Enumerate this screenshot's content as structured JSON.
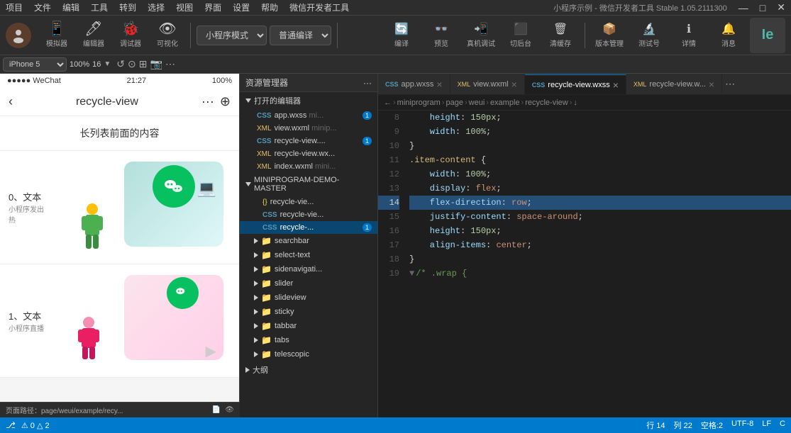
{
  "menu": {
    "items": [
      "项目",
      "文件",
      "编辑",
      "工具",
      "转到",
      "选择",
      "视图",
      "界面",
      "设置",
      "帮助",
      "微信开发者工具"
    ],
    "title_right": "小程序示例 - 微信开发者工具 Stable 1.05.2111300"
  },
  "toolbar": {
    "avatar_text": "👤",
    "simulator_label": "模拟器",
    "editor_label": "编辑器",
    "debugger_label": "调试器",
    "visible_label": "可视化",
    "mode_select": "小程序模式",
    "compile_select": "普通编译",
    "compile_label": "编译",
    "preview_label": "预览",
    "real_debug_label": "真机调试",
    "backend_label": "切后台",
    "clear_label": "清缓存",
    "version_label": "版本管理",
    "test_label": "测试号",
    "detail_label": "详情",
    "msg_label": "消息",
    "logo_text": "Ie"
  },
  "toolbar2": {
    "device": "iPhone 5",
    "zoom": "100%",
    "scale": "16"
  },
  "file_panel": {
    "header": "资源管理器",
    "header_more": "···",
    "section_open": "打开的编辑器",
    "files_open": [
      {
        "name": "app.wxss",
        "desc": "mi...",
        "badge": "1",
        "icon": "css"
      },
      {
        "name": "view.wxml",
        "desc": "minip...",
        "badge": "",
        "icon": "wxml"
      },
      {
        "name": "recycle-view....",
        "desc": "",
        "badge": "1",
        "icon": "css"
      },
      {
        "name": "recycle-view.wx...",
        "desc": "",
        "badge": "",
        "icon": "wxml"
      },
      {
        "name": "index.wxml",
        "desc": "mini...",
        "badge": "",
        "icon": "wxml"
      }
    ],
    "section_mini": "MINIPROGRAM-DEMO-MASTER",
    "folders": [
      {
        "name": "recycle-vie...",
        "icon": "js"
      },
      {
        "name": "recycle-vie...",
        "icon": "css"
      },
      {
        "name": "recycle-...",
        "icon": "css",
        "badge": "1",
        "active": true
      },
      {
        "name": "searchbar",
        "icon": "folder"
      },
      {
        "name": "select-text",
        "icon": "folder"
      },
      {
        "name": "sidenavigati...",
        "icon": "folder"
      },
      {
        "name": "slider",
        "icon": "folder"
      },
      {
        "name": "slideview",
        "icon": "folder"
      },
      {
        "name": "sticky",
        "icon": "folder"
      },
      {
        "name": "tabbar",
        "icon": "folder"
      },
      {
        "name": "tabs",
        "icon": "folder"
      },
      {
        "name": "telescopic",
        "icon": "folder"
      }
    ],
    "section_outline": "大纲"
  },
  "editor_tabs": [
    {
      "name": "app.wxss",
      "icon": "css",
      "active": false
    },
    {
      "name": "view.wxml",
      "icon": "wxml",
      "active": false
    },
    {
      "name": "recycle-view.wxss",
      "icon": "css",
      "active": true,
      "modified": false
    },
    {
      "name": "recycle-view.w...",
      "icon": "wxml",
      "active": false
    }
  ],
  "breadcrumb": {
    "path": [
      "miniprogram",
      "page",
      "weui",
      "example",
      "recycle-view",
      "↓"
    ]
  },
  "code": {
    "lines": [
      {
        "num": 8,
        "content": "    height: 150px;",
        "highlight": false
      },
      {
        "num": 9,
        "content": "    width: 100%;",
        "highlight": false
      },
      {
        "num": 10,
        "content": "}",
        "highlight": false
      },
      {
        "num": 11,
        "content": ".item-content {",
        "highlight": false
      },
      {
        "num": 12,
        "content": "    width: 100%;",
        "highlight": false
      },
      {
        "num": 13,
        "content": "    display: flex;",
        "highlight": false
      },
      {
        "num": 14,
        "content": "    flex-direction: row;",
        "highlight": true
      },
      {
        "num": 15,
        "content": "    justify-content: space-around;",
        "highlight": false
      },
      {
        "num": 16,
        "content": "    height: 150px;",
        "highlight": false
      },
      {
        "num": 17,
        "content": "    align-items: center;",
        "highlight": false
      },
      {
        "num": 18,
        "content": "}",
        "highlight": false
      },
      {
        "num": 19,
        "content": "/* .wrap {",
        "highlight": false
      }
    ]
  },
  "status_bar": {
    "errors": "0",
    "warnings": "2",
    "line": "行 14",
    "col": "列 22",
    "spaces": "空格:2",
    "encoding": "UTF-8",
    "lf": "LF",
    "lang": "C",
    "git_branch": ""
  },
  "phone": {
    "status_time": "21:27",
    "status_signal": "●●●●● WeChat",
    "status_battery": "100%",
    "nav_title": "recycle-view",
    "header_text": "长列表前面的内容",
    "item0_label": "0、文本",
    "item0_sublabel": "小程序发出热",
    "item1_label": "1、文本",
    "item1_sublabel": "小程序直播",
    "footer_path": "页面路径：page/weui/example/recy..."
  }
}
